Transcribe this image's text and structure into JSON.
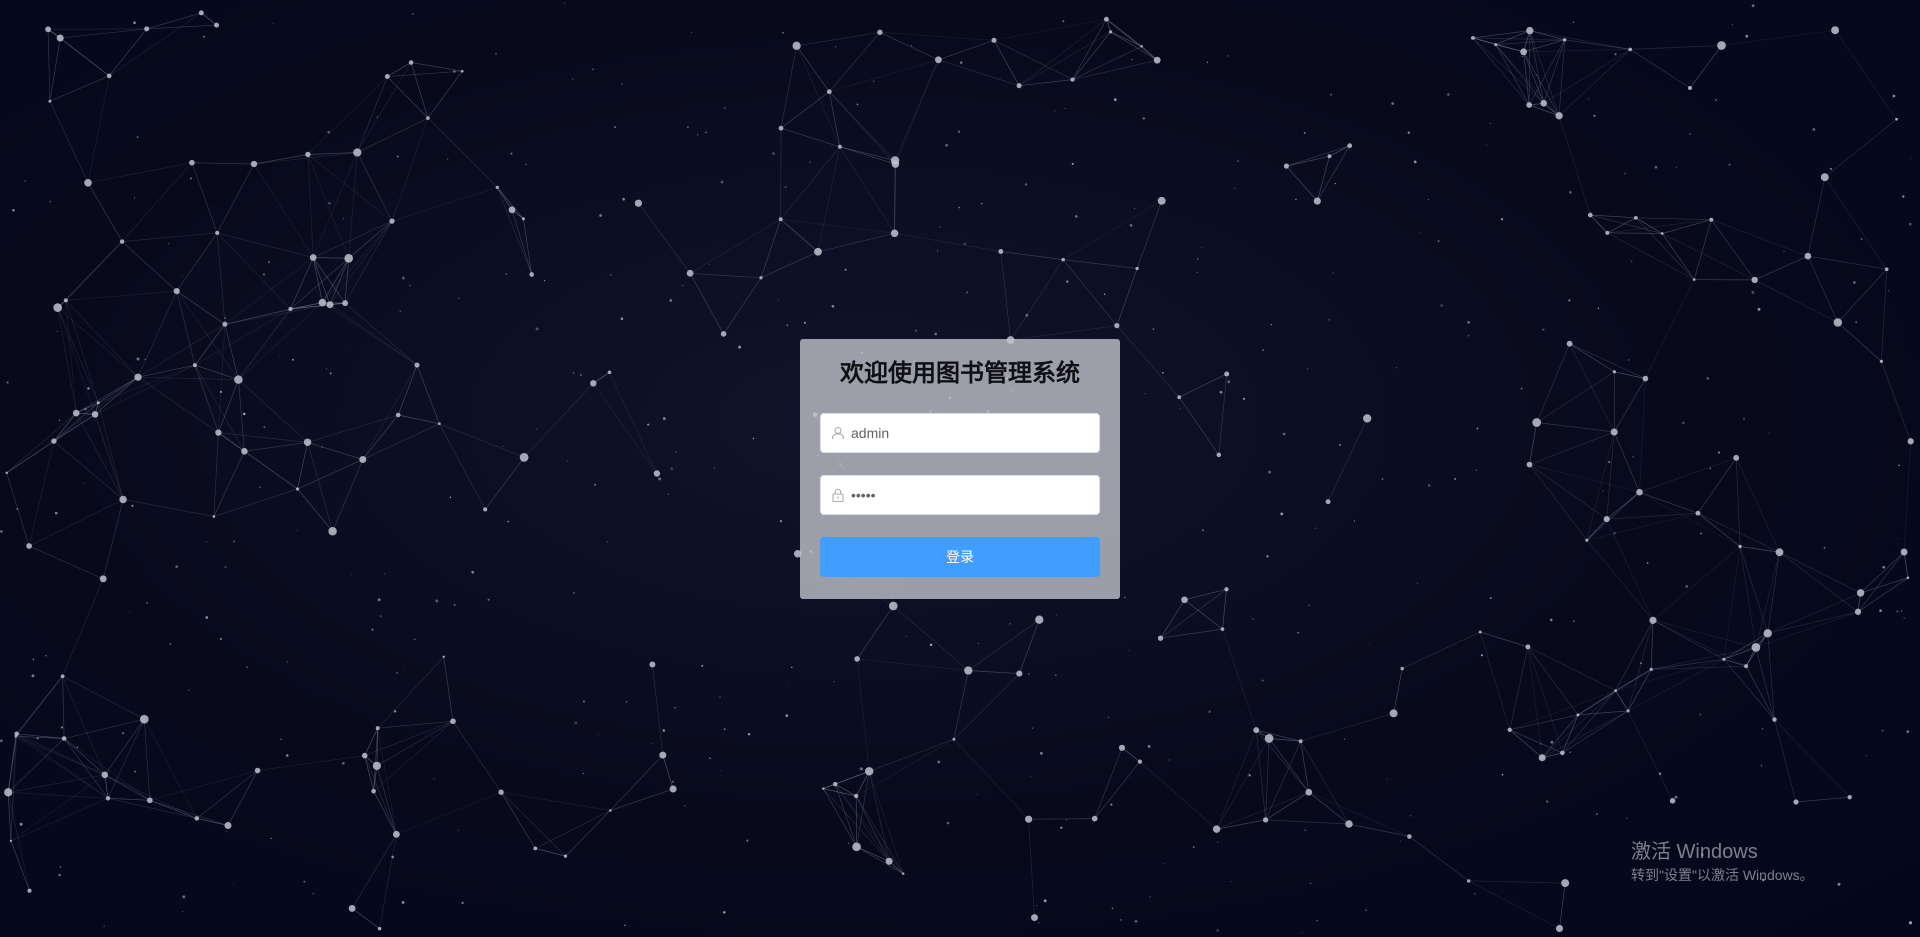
{
  "login": {
    "title": "欢迎使用图书管理系统",
    "username_value": "admin",
    "password_value": "•••••",
    "submit_label": "登录"
  },
  "watermark": {
    "title": "激活 Windows",
    "subtitle": "转到\"设置\"以激活 Windows。"
  },
  "icons": {
    "username": "user-icon",
    "password": "lock-icon"
  },
  "colors": {
    "background": "#060818",
    "card": "#c4c6ce",
    "primary_button": "#409eff",
    "network_lines": "#8a8fa6",
    "network_nodes": "#bfc2cf"
  }
}
